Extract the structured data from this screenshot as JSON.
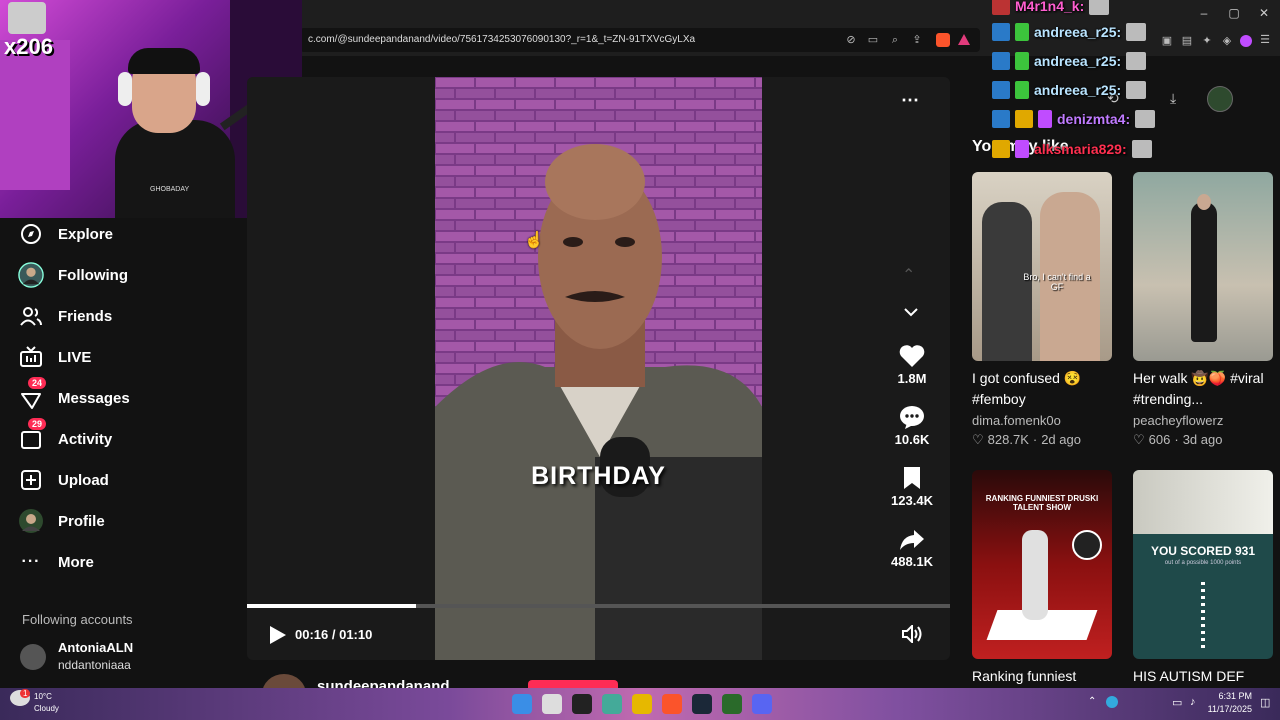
{
  "browser": {
    "url": "c.com/@sundeepandanand/video/7561734253076090130?_r=1&_t=ZN-91TXVcGyLXa"
  },
  "webcam": {
    "multiplier": "x206",
    "shirt_text": "GHOBADAY"
  },
  "sidebar": {
    "items": [
      {
        "label": "Explore",
        "icon": "compass-icon"
      },
      {
        "label": "Following",
        "icon": "following-avatar-icon"
      },
      {
        "label": "Friends",
        "icon": "friends-icon"
      },
      {
        "label": "LIVE",
        "icon": "live-tv-icon"
      },
      {
        "label": "Messages",
        "icon": "messages-icon",
        "badge": "24"
      },
      {
        "label": "Activity",
        "icon": "activity-icon",
        "badge": "29"
      },
      {
        "label": "Upload",
        "icon": "upload-icon"
      },
      {
        "label": "Profile",
        "icon": "profile-avatar-icon"
      },
      {
        "label": "More",
        "icon": "more-dots-icon"
      }
    ],
    "following_header": "Following accounts",
    "following": [
      {
        "name": "AntoniaALN",
        "handle": "nddantoniaaa"
      }
    ]
  },
  "player": {
    "caption": "BIRTHDAY",
    "time": "00:16 / 01:10",
    "progress": 0.24,
    "author_partial": "sundeepandanand",
    "actions": {
      "likes": "1.8M",
      "comments": "10.6K",
      "saves": "123.4K",
      "shares": "488.1K"
    }
  },
  "recommend": {
    "header": "You may like",
    "cards": [
      {
        "title": "I got confused 😵 #femboy",
        "author": "dima.fomenk0o",
        "likes": "828.7K",
        "age": "2d ago",
        "overlay": "Bro, I can't find a GF"
      },
      {
        "title": "Her walk 🤠🍑 #viral #trending...",
        "author": "peacheyflowerz",
        "likes": "606",
        "age": "3d ago",
        "overlay": ""
      },
      {
        "title": "Ranking funniest",
        "overlay": "RANKING FUNNIEST DRUSKI TALENT SHOW"
      },
      {
        "title": "HIS AUTISM DEF",
        "overlay": "YOU SCORED 931",
        "overlay_sub": "out of a possible 1000 points"
      }
    ]
  },
  "chat": [
    {
      "user": "M4r1n4_k:",
      "color": "#ff5fd0"
    },
    {
      "user": "andreea_r25:",
      "color": "#b9e4ff"
    },
    {
      "user": "andreea_r25:",
      "color": "#b9e4ff"
    },
    {
      "user": "andreea_r25:",
      "color": "#b9e4ff"
    },
    {
      "user": "denizmta4:",
      "color": "#c07bff"
    },
    {
      "user": "alksmaria829:",
      "color": "#ff3050"
    }
  ],
  "taskbar": {
    "temp": "10°C",
    "weather": "Cloudy",
    "time": "6:31 PM",
    "date": "11/17/2025"
  }
}
